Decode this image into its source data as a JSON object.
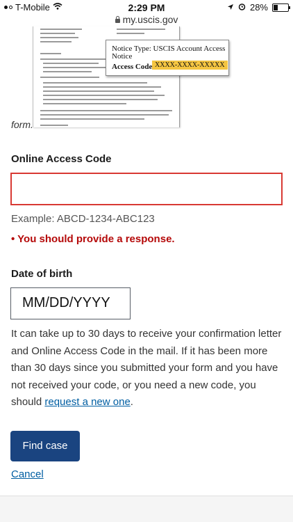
{
  "status_bar": {
    "carrier": "T-Mobile",
    "time": "2:29 PM",
    "battery": "28%"
  },
  "url_bar": {
    "domain": "my.uscis.gov"
  },
  "letter_image": {
    "callout_notice_type": "Notice Type: USCIS Account Access Notice",
    "callout_access_code_label": "Access Code:",
    "callout_access_code_value": "XXXX-XXXX-XXXXX",
    "caption_tail": "form."
  },
  "access_code": {
    "label": "Online Access Code",
    "value": "",
    "hint": "Example: ABCD-1234-ABC123",
    "error": "• You should provide a response."
  },
  "dob": {
    "label": "Date of birth",
    "placeholder": "MM/DD/YYYY"
  },
  "info": {
    "text": "It can take up to 30 days to receive your confirmation letter and Online Access Code in the mail. If it has been more than 30 days since you submitted your form and you have not received your code, or you need a new code, you should ",
    "link": "request a new one",
    "end": "."
  },
  "actions": {
    "find_case": "Find case",
    "cancel": "Cancel"
  }
}
